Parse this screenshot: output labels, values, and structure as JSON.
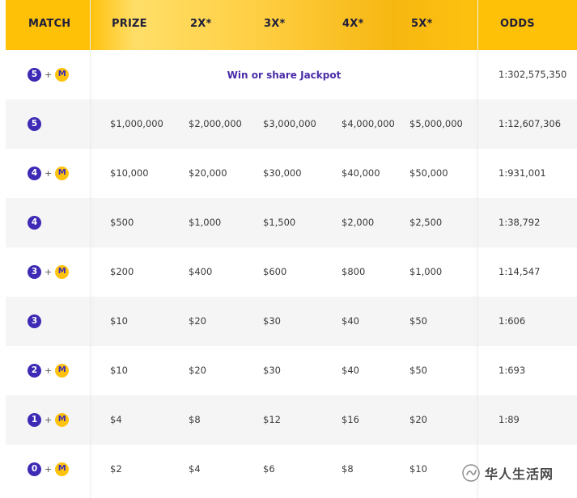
{
  "header": {
    "match": "MATCH",
    "prize": "PRIZE",
    "x2": "2X*",
    "x3": "3X*",
    "x4": "4X*",
    "x5": "5X*",
    "odds": "ODDS"
  },
  "rows": [
    {
      "balls": "5",
      "mega": "M",
      "jackpot": "Win or share Jackpot",
      "odds": "1:302,575,350"
    },
    {
      "balls": "5",
      "prize": "$1,000,000",
      "x2": "$2,000,000",
      "x3": "$3,000,000",
      "x4": "$4,000,000",
      "x5": "$5,000,000",
      "odds": "1:12,607,306"
    },
    {
      "balls": "4",
      "mega": "M",
      "prize": "$10,000",
      "x2": "$20,000",
      "x3": "$30,000",
      "x4": "$40,000",
      "x5": "$50,000",
      "odds": "1:931,001"
    },
    {
      "balls": "4",
      "prize": "$500",
      "x2": "$1,000",
      "x3": "$1,500",
      "x4": "$2,000",
      "x5": "$2,500",
      "odds": "1:38,792"
    },
    {
      "balls": "3",
      "mega": "M",
      "prize": "$200",
      "x2": "$400",
      "x3": "$600",
      "x4": "$800",
      "x5": "$1,000",
      "odds": "1:14,547"
    },
    {
      "balls": "3",
      "prize": "$10",
      "x2": "$20",
      "x3": "$30",
      "x4": "$40",
      "x5": "$50",
      "odds": "1:606"
    },
    {
      "balls": "2",
      "mega": "M",
      "prize": "$10",
      "x2": "$20",
      "x3": "$30",
      "x4": "$40",
      "x5": "$50",
      "odds": "1:693"
    },
    {
      "balls": "1",
      "mega": "M",
      "prize": "$4",
      "x2": "$8",
      "x3": "$12",
      "x4": "$16",
      "x5": "$20",
      "odds": "1:89"
    },
    {
      "balls": "0",
      "mega": "M",
      "prize": "$2",
      "x2": "$4",
      "x3": "$6",
      "x4": "$8",
      "x5": "$10",
      "odds": ""
    }
  ],
  "plus_sign": "+",
  "watermark": {
    "text": "华人生活网",
    "icon": "wechat-official-account-icon"
  },
  "colors": {
    "header": "#ffc20e",
    "ball": "#3d2ab5",
    "mega_ball": "#ffc20e",
    "jackpot_text": "#4a2ca8",
    "row_shade": "#f5f5f5"
  }
}
